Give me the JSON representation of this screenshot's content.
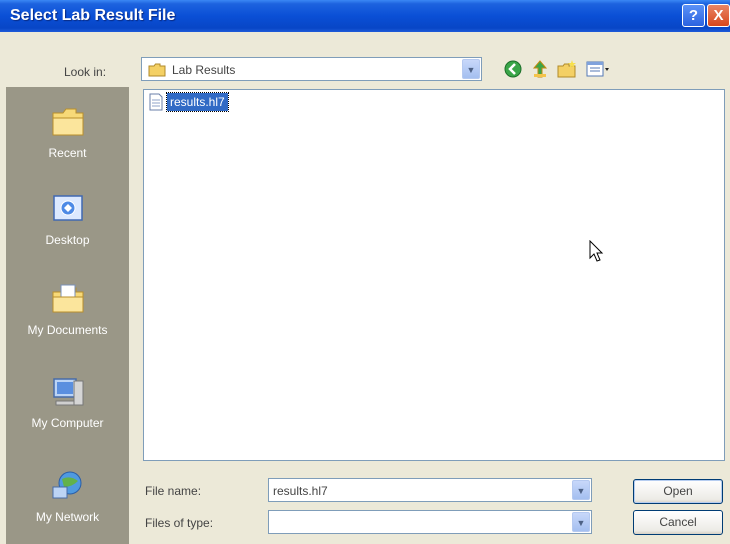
{
  "window": {
    "title": "Select Lab Result File",
    "help_glyph": "?",
    "close_glyph": "X"
  },
  "lookin": {
    "label": "Look in:",
    "value": "Lab Results",
    "arrow_glyph": "▼"
  },
  "toolbar": {
    "icons": [
      "back-icon",
      "up-folder-icon",
      "new-folder-icon",
      "view-menu-icon"
    ]
  },
  "places": [
    {
      "label": "Recent",
      "icon": "recent-folder-icon"
    },
    {
      "label": "Desktop",
      "icon": "desktop-icon"
    },
    {
      "label": "My Documents",
      "icon": "my-documents-icon"
    },
    {
      "label": "My Computer",
      "icon": "my-computer-icon"
    },
    {
      "label": "My Network",
      "icon": "my-network-icon"
    }
  ],
  "files": [
    {
      "name": "results.hl7",
      "selected": true
    }
  ],
  "filename": {
    "label": "File name:",
    "value": "results.hl7"
  },
  "filetype": {
    "label": "Files of type:",
    "value": ""
  },
  "buttons": {
    "open": "Open",
    "cancel": "Cancel"
  },
  "colors": {
    "titlebar": "#0a4fd6",
    "selection": "#316ac5",
    "places_bg": "#9a9787",
    "dialog_bg": "#ece9d8"
  }
}
